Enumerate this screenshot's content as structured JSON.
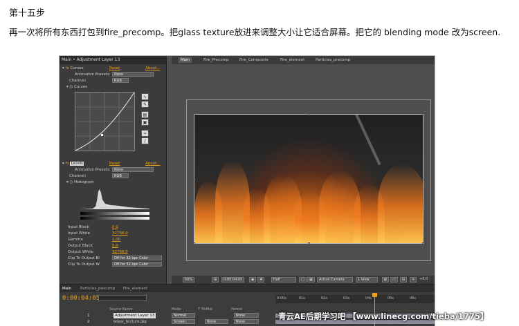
{
  "step_title": "第十五步",
  "instruction": "再一次将所有东西打包到fire_precomp。把glass texture放进来调整大小让它适合屏幕。把它的 blending mode 改为screen.",
  "effects_panel": {
    "header": "Main • Adjustment Layer 13",
    "curves": {
      "name": "Curves",
      "reset": "Reset",
      "about": "About...",
      "presets_label": "Animation Presets:",
      "presets_value": "None",
      "channel_label": "Channel:",
      "channel_value": "RGB",
      "sub_label": "Curves"
    },
    "levels": {
      "name": "Levels",
      "reset": "Reset",
      "about": "About...",
      "presets_label": "Animation Presets:",
      "presets_value": "None",
      "channel_label": "Channel:",
      "channel_value": "RGB",
      "histogram_label": "Histogram",
      "params": [
        {
          "label": "Input Black",
          "value": "0,0"
        },
        {
          "label": "Input White",
          "value": "32768,0"
        },
        {
          "label": "Gamma",
          "value": "1,00"
        },
        {
          "label": "Output Black",
          "value": "0,0"
        },
        {
          "label": "Output White",
          "value": "32768,0"
        },
        {
          "label": "Clip To Output Bl",
          "value": "Off for 32 bpc Color"
        },
        {
          "label": "Clip To Output W",
          "value": "Off for 32 bpc Color"
        }
      ]
    }
  },
  "comp_tabs": [
    "Main",
    "Fire_Precomp",
    "Fire_Composite",
    "Fire_element",
    "Particles_precomp"
  ],
  "viewer_toolbar": {
    "zoom": "50%",
    "timecode": "0:00:04:05",
    "resolution": "Half",
    "camera": "Active Camera",
    "views": "1 View",
    "exposure": "+0,0"
  },
  "timeline": {
    "tabs": [
      "Main",
      "Particles_precomp",
      "Fire_element"
    ],
    "timecode": "0:00:04:05",
    "columns": {
      "source": "Source Name",
      "mode": "Mode",
      "trkmat": "T TrkMat",
      "parent": "Parent"
    },
    "layers": [
      {
        "num": "1",
        "name": "Adjustment Layer 13",
        "mode": "Normal",
        "trkmat": "",
        "parent": "None"
      },
      {
        "num": "2",
        "name": "Glass_texture.jpg",
        "mode": "Screen",
        "trkmat": "None",
        "parent": "None"
      }
    ],
    "ruler_ticks": [
      "0:00s",
      "01s",
      "02s",
      "03s",
      "04s",
      "05s",
      "06s"
    ]
  },
  "watermark": "青云AE后期学习吧 【www.linecg.com/tieba/1775】",
  "colors": {
    "accent": "#e8a020",
    "panel": "#3b3b3b",
    "viewer": "#4e4e4e"
  }
}
